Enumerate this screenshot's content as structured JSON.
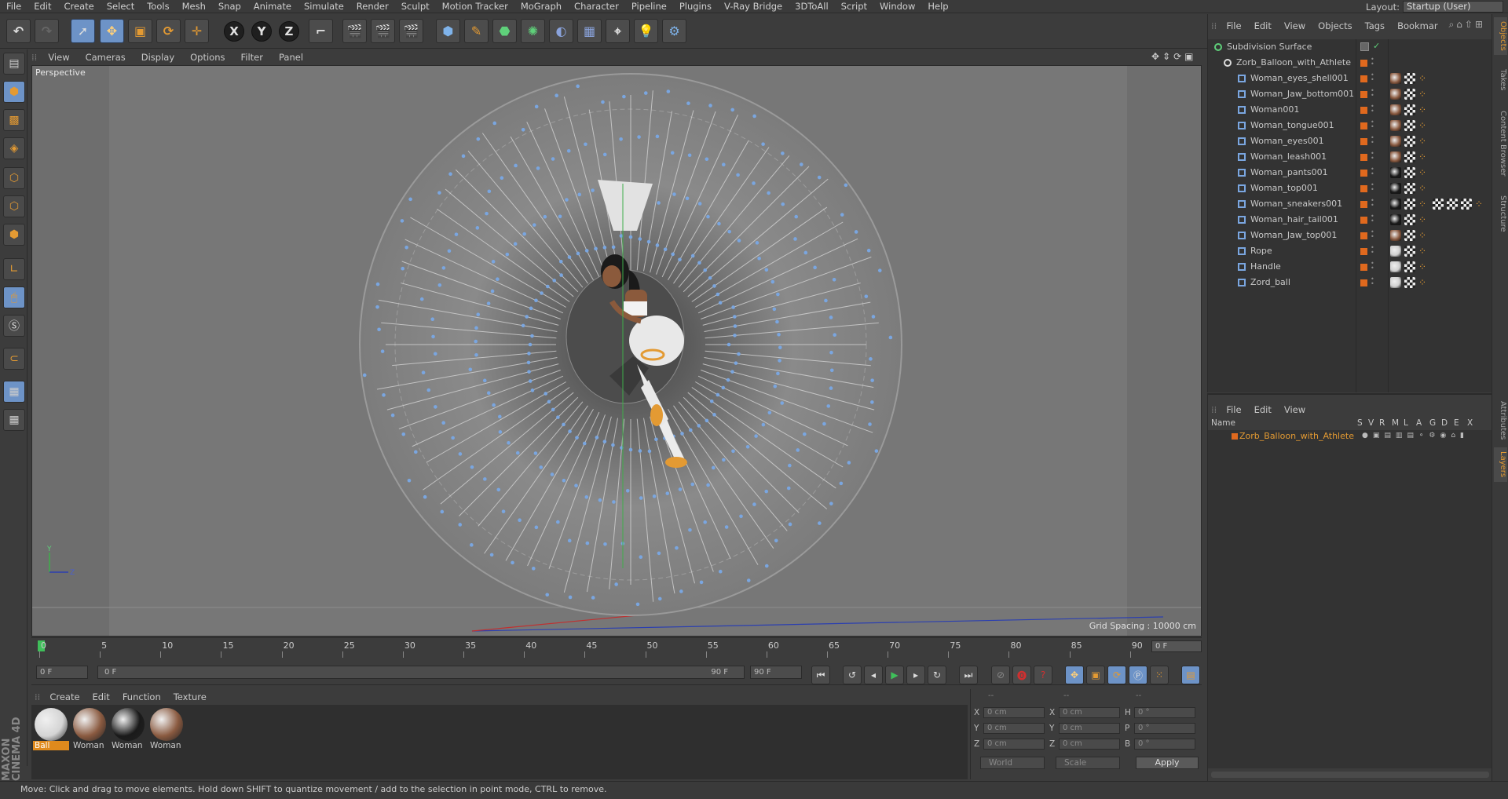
{
  "menu": [
    "File",
    "Edit",
    "Create",
    "Select",
    "Tools",
    "Mesh",
    "Snap",
    "Animate",
    "Simulate",
    "Render",
    "Sculpt",
    "Motion Tracker",
    "MoGraph",
    "Character",
    "Pipeline",
    "Plugins",
    "V-Ray Bridge",
    "3DToAll",
    "Script",
    "Window",
    "Help"
  ],
  "layout": {
    "label": "Layout:",
    "value": "Startup (User)"
  },
  "toolbar": {
    "x": "X",
    "y": "Y",
    "z": "Z"
  },
  "viewport": {
    "menu": [
      "View",
      "Cameras",
      "Display",
      "Options",
      "Filter",
      "Panel"
    ],
    "camera": "Perspective",
    "grid_spacing": "Grid Spacing : 10000 cm",
    "axis_y": "Y",
    "axis_z": "Z"
  },
  "timeline": {
    "ticks": [
      "0",
      "5",
      "10",
      "15",
      "20",
      "25",
      "30",
      "35",
      "40",
      "45",
      "50",
      "55",
      "60",
      "65",
      "70",
      "75",
      "80",
      "85",
      "90"
    ],
    "current_frame": "0 F",
    "start_field": "0 F",
    "range_start": "0 F",
    "range_end": "90 F",
    "end_field": "90 F"
  },
  "materials": {
    "menu": [
      "Create",
      "Edit",
      "Function",
      "Texture"
    ],
    "items": [
      {
        "label": "Ball",
        "color": "#d4d4d4",
        "selected": true
      },
      {
        "label": "Woman",
        "color": "#8a5a40",
        "selected": false
      },
      {
        "label": "Woman",
        "color": "#1a1a1a",
        "selected": false
      },
      {
        "label": "Woman",
        "color": "#8a5a40",
        "selected": false
      }
    ]
  },
  "coords": {
    "headers": [
      "--",
      "--",
      "--"
    ],
    "rows": [
      {
        "a": "X",
        "av": "0 cm",
        "b": "X",
        "bv": "0 cm",
        "c": "H",
        "cv": "0 °"
      },
      {
        "a": "Y",
        "av": "0 cm",
        "b": "Y",
        "bv": "0 cm",
        "c": "P",
        "cv": "0 °"
      },
      {
        "a": "Z",
        "av": "0 cm",
        "b": "Z",
        "bv": "0 cm",
        "c": "B",
        "cv": "0 °"
      }
    ],
    "world": "World",
    "scale": "Scale",
    "apply": "Apply"
  },
  "objects": {
    "menu": [
      "File",
      "Edit",
      "View",
      "Objects",
      "Tags",
      "Bookmar"
    ],
    "items": [
      {
        "name": "Subdivision Surface",
        "level": 0
      },
      {
        "name": "Zorb_Balloon_with_Athlete",
        "level": 1
      },
      {
        "name": "Woman_eyes_shell001",
        "level": 2
      },
      {
        "name": "Woman_Jaw_bottom001",
        "level": 2
      },
      {
        "name": "Woman001",
        "level": 2
      },
      {
        "name": "Woman_tongue001",
        "level": 2
      },
      {
        "name": "Woman_eyes001",
        "level": 2
      },
      {
        "name": "Woman_leash001",
        "level": 2
      },
      {
        "name": "Woman_pants001",
        "level": 2
      },
      {
        "name": "Woman_top001",
        "level": 2
      },
      {
        "name": "Woman_sneakers001",
        "level": 2
      },
      {
        "name": "Woman_hair_tail001",
        "level": 2
      },
      {
        "name": "Woman_Jaw_top001",
        "level": 2
      },
      {
        "name": "Rope",
        "level": 2
      },
      {
        "name": "Handle",
        "level": 2
      },
      {
        "name": "Zord_ball",
        "level": 2
      }
    ]
  },
  "layers": {
    "menu": [
      "File",
      "Edit",
      "View"
    ],
    "columns": [
      "Name",
      "S",
      "V",
      "R",
      "M",
      "L",
      "A",
      "G",
      "D",
      "E",
      "X"
    ],
    "row": "Zorb_Balloon_with_Athlete"
  },
  "side_tabs": [
    "Objects",
    "Takes",
    "Content Browser",
    "Structure",
    "Attributes",
    "Layers"
  ],
  "status": "Move: Click and drag to move elements. Hold down SHIFT to quantize movement / add to the selection in point mode, CTRL to remove.",
  "brand": "MAXON CINEMA 4D"
}
